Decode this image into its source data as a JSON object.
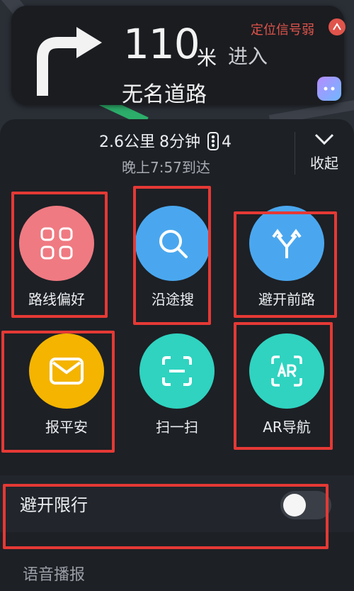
{
  "guidance": {
    "distance_value": "110",
    "distance_unit": "米",
    "action": "进入",
    "road_name": "无名道路",
    "signal_status": "定位信号弱"
  },
  "sheet": {
    "distance": "2.6公里",
    "duration": "8分钟",
    "traffic_lights": "4",
    "arrival": "晚上7:57到达",
    "collapse_label": "收起"
  },
  "tiles": [
    {
      "label": "路线偏好",
      "color": "#ef7a82",
      "icon": "grid-icon"
    },
    {
      "label": "沿途搜",
      "color": "#4aa7ef",
      "icon": "search-icon"
    },
    {
      "label": "避开前路",
      "color": "#4aa7ef",
      "icon": "fork-arrows-icon"
    },
    {
      "label": "报平安",
      "color": "#f4b400",
      "icon": "envelope-icon"
    },
    {
      "label": "扫一扫",
      "color": "#2fd3c0",
      "icon": "scan-icon"
    },
    {
      "label": "AR导航",
      "color": "#2fd3c0",
      "icon": "ar-icon"
    }
  ],
  "avoid_restriction": {
    "label": "避开限行",
    "enabled": false
  },
  "voice_broadcast": {
    "label": "语音播报"
  },
  "colors": {
    "background": "#1b1e23",
    "panel": "#1d2025",
    "highlight": "#e53935",
    "warning": "#e0544b"
  }
}
